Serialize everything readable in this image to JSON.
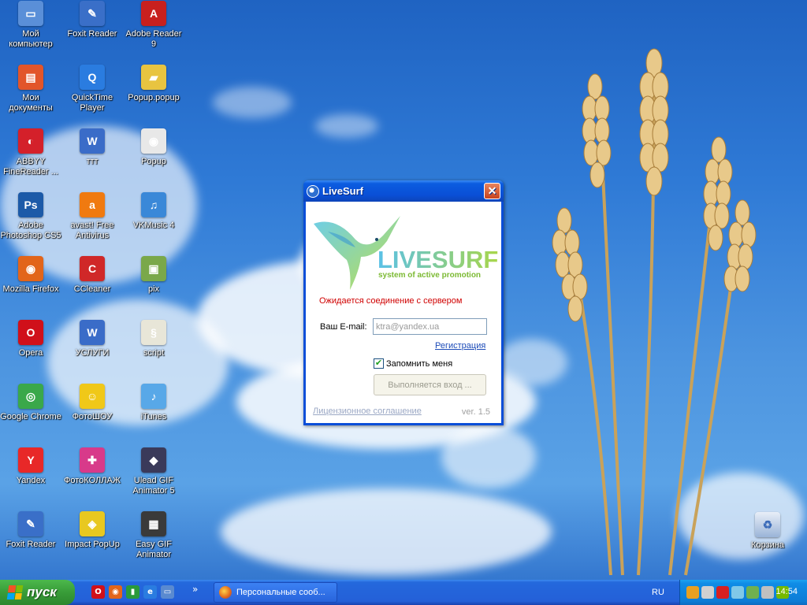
{
  "desktop_icons": [
    {
      "label": "Мой компьютер",
      "icon": "my-computer-icon",
      "color": "#5a8fd8",
      "glyph": "▭"
    },
    {
      "label": "Foxit Reader",
      "icon": "foxit-reader-icon",
      "color": "#3a6fc8",
      "glyph": "✎"
    },
    {
      "label": "Adobe Reader 9",
      "icon": "adobe-reader-icon",
      "color": "#c8201e",
      "glyph": "A"
    },
    {
      "label": "Мои документы",
      "icon": "my-documents-icon",
      "color": "#e2552a",
      "glyph": "▤"
    },
    {
      "label": "QuickTime Player",
      "icon": "quicktime-icon",
      "color": "#2a7ce0",
      "glyph": "Q"
    },
    {
      "label": "Popup.popup",
      "icon": "folder-icon",
      "color": "#e8c440",
      "glyph": "▰"
    },
    {
      "label": "ABBYY FineReader ...",
      "icon": "abbyy-icon",
      "color": "#d4202a",
      "glyph": "◐"
    },
    {
      "label": "ттт",
      "icon": "word-document-icon",
      "color": "#3a6cc8",
      "glyph": "W"
    },
    {
      "label": "Popup",
      "icon": "firefox-document-icon",
      "color": "#e8e8e8",
      "glyph": "◉"
    },
    {
      "label": "Adobe Photoshop CS5",
      "icon": "photoshop-icon",
      "color": "#1c5aa8",
      "glyph": "Ps"
    },
    {
      "label": "avast! Free Antivirus",
      "icon": "avast-icon",
      "color": "#f07a10",
      "glyph": "a"
    },
    {
      "label": "VKMusic 4",
      "icon": "vkmusic-icon",
      "color": "#3a88d8",
      "glyph": "♫"
    },
    {
      "label": "Mozilla Firefox",
      "icon": "firefox-icon",
      "color": "#e2651a",
      "glyph": "◉"
    },
    {
      "label": "CCleaner",
      "icon": "ccleaner-icon",
      "color": "#d02828",
      "glyph": "C"
    },
    {
      "label": "pix",
      "icon": "image-icon",
      "color": "#7aa84a",
      "glyph": "▣"
    },
    {
      "label": "Opera",
      "icon": "opera-icon",
      "color": "#d0101a",
      "glyph": "O"
    },
    {
      "label": "УСЛУГИ",
      "icon": "word-document-icon",
      "color": "#3a6cc8",
      "glyph": "W"
    },
    {
      "label": "script",
      "icon": "script-icon",
      "color": "#e8e6d8",
      "glyph": "§"
    },
    {
      "label": "Google Chrome",
      "icon": "chrome-icon",
      "color": "#3aa84a",
      "glyph": "◎"
    },
    {
      "label": "ФотоШОУ",
      "icon": "smiley-icon",
      "color": "#f0c818",
      "glyph": "☺"
    },
    {
      "label": "iTunes",
      "icon": "itunes-icon",
      "color": "#58a8e8",
      "glyph": "♪"
    },
    {
      "label": "Yandex",
      "icon": "yandex-icon",
      "color": "#e82828",
      "glyph": "Y"
    },
    {
      "label": "ФотоКОЛЛАЖ",
      "icon": "puzzle-icon",
      "color": "#d83a8a",
      "glyph": "✚"
    },
    {
      "label": "Ulead GIF Animator 5",
      "icon": "ulead-icon",
      "color": "#3a3a5a",
      "glyph": "◆"
    },
    {
      "label": "Foxit Reader",
      "icon": "foxit-reader-icon",
      "color": "#3a6fc8",
      "glyph": "✎"
    },
    {
      "label": "Impact PopUp",
      "icon": "impact-popup-icon",
      "color": "#e8c820",
      "glyph": "◈"
    },
    {
      "label": "Easy GIF Animator",
      "icon": "film-icon",
      "color": "#3a3a3a",
      "glyph": "▦"
    }
  ],
  "recycle_bin": {
    "label": "Корзина",
    "icon": "recycle-bin-icon"
  },
  "dialog": {
    "title": "LiveSurf",
    "logo_text": "LIVESURF",
    "logo_subtitle": "system of active promotion",
    "status": "Ожидается соединение с сервером",
    "email_label": "Ваш E-mail:",
    "email_placeholder": "ktra@yandex.ua",
    "register_link": "Регистрация",
    "remember_label": "Запомнить меня",
    "remember_checked": true,
    "login_button": "Выполняется вход ...",
    "license_link": "Лицензионное соглашение",
    "version": "ver. 1.5"
  },
  "taskbar": {
    "start_label": "пуск",
    "quick_launch": [
      {
        "icon": "opera-icon",
        "color": "#d0101a",
        "glyph": "O"
      },
      {
        "icon": "firefox-icon",
        "color": "#e2651a",
        "glyph": "◉"
      },
      {
        "icon": "green-app-icon",
        "color": "#2a9a3a",
        "glyph": "▮"
      },
      {
        "icon": "internet-explorer-icon",
        "color": "#2a7ce0",
        "glyph": "e"
      },
      {
        "icon": "show-desktop-icon",
        "color": "#5a8ad0",
        "glyph": "▭"
      }
    ],
    "more_glyph": "»",
    "task_button_label": "Персональные сооб...",
    "language": "RU",
    "clock": "14:54",
    "tray_icons": [
      {
        "icon": "chrome-tray-icon",
        "color": "#e8a020"
      },
      {
        "icon": "skype-tray-icon",
        "color": "#d0d0d0"
      },
      {
        "icon": "russian-flag-icon",
        "color": "#d82020"
      },
      {
        "icon": "livesurf-tray-icon",
        "color": "#80c8e8"
      },
      {
        "icon": "network-tray-icon",
        "color": "#70b050"
      },
      {
        "icon": "volume-tray-icon",
        "color": "#c0c0c0"
      },
      {
        "icon": "nvidia-tray-icon",
        "color": "#76b900"
      }
    ]
  }
}
